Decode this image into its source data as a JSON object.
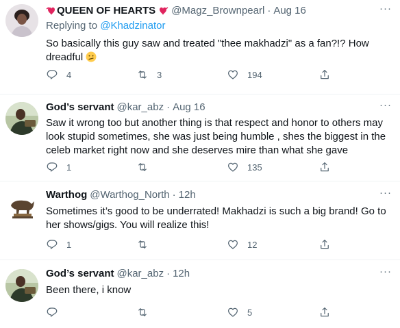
{
  "tweets": [
    {
      "name": "QUEEN OF HEARTS",
      "handle": "@Magz_Brownpearl",
      "time": "Aug 16",
      "replying_prefix": "Replying to",
      "replying_to": "@Khadzinator",
      "text": "So basically this guy saw and treated \"thee makhadzi\" as a fan?!? How dreadful",
      "replies": "4",
      "retweets": "3",
      "likes": "194"
    },
    {
      "name": "God’s servant",
      "handle": "@kar_abz",
      "time": "Aug 16",
      "text": "Saw it wrong too but another thing is that respect and honor to others may look stupid sometimes, she was just being humble , shes the biggest in the celeb market right now and she deserves mire than what she gave",
      "replies": "1",
      "retweets": "",
      "likes": "135"
    },
    {
      "name": "Warthog",
      "handle": "@Warthog_North",
      "time": "12h",
      "text": "Sometimes it’s good to be underrated! Makhadzi is such a big brand! Go to her shows/gigs. You will realize this!",
      "replies": "1",
      "retweets": "",
      "likes": "12"
    },
    {
      "name": "God’s servant",
      "handle": "@kar_abz",
      "time": "12h",
      "text": "Been there, i know",
      "replies": "",
      "retweets": "",
      "likes": "5"
    }
  ],
  "separator": "·",
  "more_glyph": "···",
  "colors": {
    "accent": "#1d9bf0",
    "secondary_text": "#536471",
    "heart_emoji": "#e0245e"
  },
  "icons": [
    "heart-emoji-icon",
    "confused-face-icon",
    "reply-icon",
    "retweet-icon",
    "like-icon",
    "share-icon",
    "more-icon"
  ]
}
